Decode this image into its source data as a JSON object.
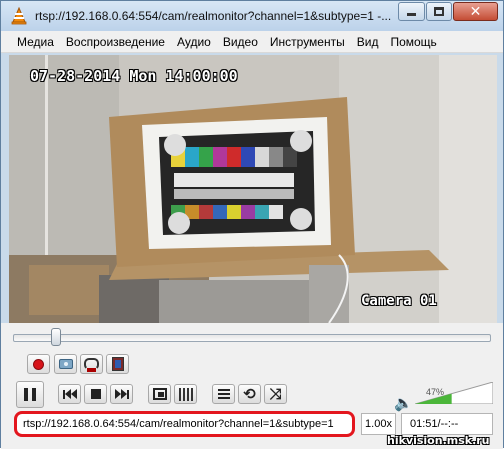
{
  "window": {
    "title": "rtsp://192.168.0.64:554/cam/realmonitor?channel=1&subtype=1 -..."
  },
  "menu": {
    "items": [
      "Медиа",
      "Воспроизведение",
      "Аудио",
      "Видео",
      "Инструменты",
      "Вид",
      "Помощь"
    ]
  },
  "video": {
    "osd_datetime": "07-28-2014 Mon 14:00:00",
    "osd_camera": "Camera 01"
  },
  "seek": {
    "position": 0.05
  },
  "volume": {
    "label": "47%",
    "level": 0.47
  },
  "status": {
    "url": "rtsp://192.168.0.64:554/cam/realmonitor?channel=1&subtype=1",
    "speed": "1.00x",
    "time": "01:51/--:--"
  },
  "watermark": "hikvision.msk.ru",
  "colors": {
    "record": "#d7141a",
    "highlight": "#e3161e",
    "volume_fill": "#4bb63a"
  },
  "icons": {
    "app": "vlc-cone-icon",
    "record": "record-icon",
    "snapshot": "camera-icon",
    "loop_ab": "loop-ab-icon",
    "frame": "frame-step-icon",
    "pause": "pause-icon",
    "previous": "previous-icon",
    "stop": "stop-icon",
    "next": "next-icon",
    "fullscreen": "fullscreen-icon",
    "extended": "extended-settings-icon",
    "playlist": "playlist-icon",
    "loop": "loop-icon",
    "shuffle": "shuffle-icon",
    "speaker": "speaker-icon"
  }
}
